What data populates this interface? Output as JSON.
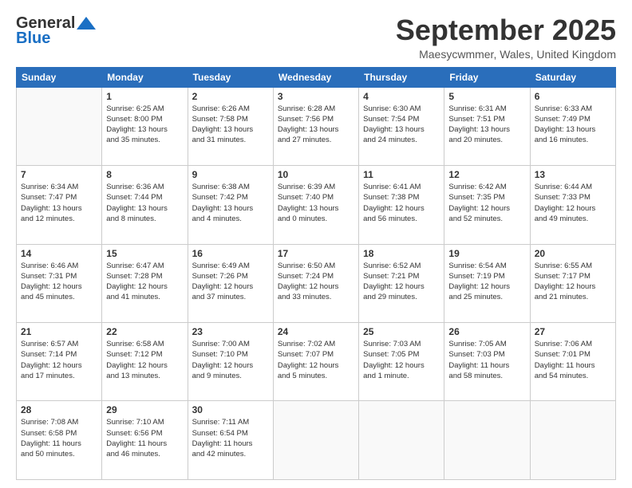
{
  "logo": {
    "line1": "General",
    "line2": "Blue"
  },
  "title": "September 2025",
  "location": "Maesycwmmer, Wales, United Kingdom",
  "weekdays": [
    "Sunday",
    "Monday",
    "Tuesday",
    "Wednesday",
    "Thursday",
    "Friday",
    "Saturday"
  ],
  "weeks": [
    [
      {
        "day": "",
        "info": ""
      },
      {
        "day": "1",
        "info": "Sunrise: 6:25 AM\nSunset: 8:00 PM\nDaylight: 13 hours\nand 35 minutes."
      },
      {
        "day": "2",
        "info": "Sunrise: 6:26 AM\nSunset: 7:58 PM\nDaylight: 13 hours\nand 31 minutes."
      },
      {
        "day": "3",
        "info": "Sunrise: 6:28 AM\nSunset: 7:56 PM\nDaylight: 13 hours\nand 27 minutes."
      },
      {
        "day": "4",
        "info": "Sunrise: 6:30 AM\nSunset: 7:54 PM\nDaylight: 13 hours\nand 24 minutes."
      },
      {
        "day": "5",
        "info": "Sunrise: 6:31 AM\nSunset: 7:51 PM\nDaylight: 13 hours\nand 20 minutes."
      },
      {
        "day": "6",
        "info": "Sunrise: 6:33 AM\nSunset: 7:49 PM\nDaylight: 13 hours\nand 16 minutes."
      }
    ],
    [
      {
        "day": "7",
        "info": "Sunrise: 6:34 AM\nSunset: 7:47 PM\nDaylight: 13 hours\nand 12 minutes."
      },
      {
        "day": "8",
        "info": "Sunrise: 6:36 AM\nSunset: 7:44 PM\nDaylight: 13 hours\nand 8 minutes."
      },
      {
        "day": "9",
        "info": "Sunrise: 6:38 AM\nSunset: 7:42 PM\nDaylight: 13 hours\nand 4 minutes."
      },
      {
        "day": "10",
        "info": "Sunrise: 6:39 AM\nSunset: 7:40 PM\nDaylight: 13 hours\nand 0 minutes."
      },
      {
        "day": "11",
        "info": "Sunrise: 6:41 AM\nSunset: 7:38 PM\nDaylight: 12 hours\nand 56 minutes."
      },
      {
        "day": "12",
        "info": "Sunrise: 6:42 AM\nSunset: 7:35 PM\nDaylight: 12 hours\nand 52 minutes."
      },
      {
        "day": "13",
        "info": "Sunrise: 6:44 AM\nSunset: 7:33 PM\nDaylight: 12 hours\nand 49 minutes."
      }
    ],
    [
      {
        "day": "14",
        "info": "Sunrise: 6:46 AM\nSunset: 7:31 PM\nDaylight: 12 hours\nand 45 minutes."
      },
      {
        "day": "15",
        "info": "Sunrise: 6:47 AM\nSunset: 7:28 PM\nDaylight: 12 hours\nand 41 minutes."
      },
      {
        "day": "16",
        "info": "Sunrise: 6:49 AM\nSunset: 7:26 PM\nDaylight: 12 hours\nand 37 minutes."
      },
      {
        "day": "17",
        "info": "Sunrise: 6:50 AM\nSunset: 7:24 PM\nDaylight: 12 hours\nand 33 minutes."
      },
      {
        "day": "18",
        "info": "Sunrise: 6:52 AM\nSunset: 7:21 PM\nDaylight: 12 hours\nand 29 minutes."
      },
      {
        "day": "19",
        "info": "Sunrise: 6:54 AM\nSunset: 7:19 PM\nDaylight: 12 hours\nand 25 minutes."
      },
      {
        "day": "20",
        "info": "Sunrise: 6:55 AM\nSunset: 7:17 PM\nDaylight: 12 hours\nand 21 minutes."
      }
    ],
    [
      {
        "day": "21",
        "info": "Sunrise: 6:57 AM\nSunset: 7:14 PM\nDaylight: 12 hours\nand 17 minutes."
      },
      {
        "day": "22",
        "info": "Sunrise: 6:58 AM\nSunset: 7:12 PM\nDaylight: 12 hours\nand 13 minutes."
      },
      {
        "day": "23",
        "info": "Sunrise: 7:00 AM\nSunset: 7:10 PM\nDaylight: 12 hours\nand 9 minutes."
      },
      {
        "day": "24",
        "info": "Sunrise: 7:02 AM\nSunset: 7:07 PM\nDaylight: 12 hours\nand 5 minutes."
      },
      {
        "day": "25",
        "info": "Sunrise: 7:03 AM\nSunset: 7:05 PM\nDaylight: 12 hours\nand 1 minute."
      },
      {
        "day": "26",
        "info": "Sunrise: 7:05 AM\nSunset: 7:03 PM\nDaylight: 11 hours\nand 58 minutes."
      },
      {
        "day": "27",
        "info": "Sunrise: 7:06 AM\nSunset: 7:01 PM\nDaylight: 11 hours\nand 54 minutes."
      }
    ],
    [
      {
        "day": "28",
        "info": "Sunrise: 7:08 AM\nSunset: 6:58 PM\nDaylight: 11 hours\nand 50 minutes."
      },
      {
        "day": "29",
        "info": "Sunrise: 7:10 AM\nSunset: 6:56 PM\nDaylight: 11 hours\nand 46 minutes."
      },
      {
        "day": "30",
        "info": "Sunrise: 7:11 AM\nSunset: 6:54 PM\nDaylight: 11 hours\nand 42 minutes."
      },
      {
        "day": "",
        "info": ""
      },
      {
        "day": "",
        "info": ""
      },
      {
        "day": "",
        "info": ""
      },
      {
        "day": "",
        "info": ""
      }
    ]
  ]
}
